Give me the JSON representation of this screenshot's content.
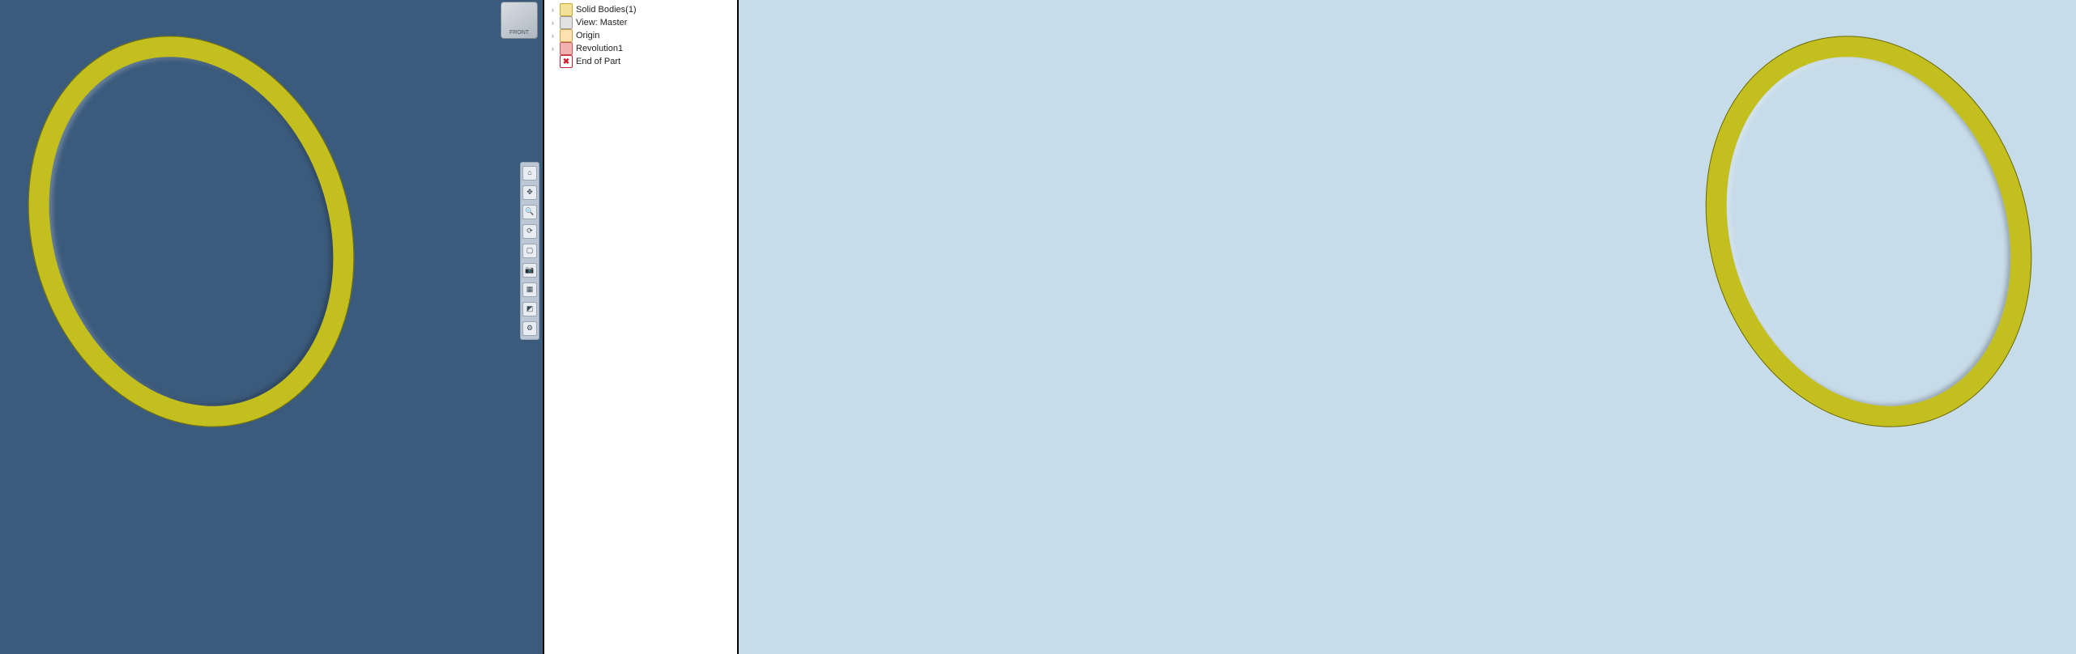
{
  "viewcube": {
    "label": "FRONT"
  },
  "side_toolbar": {
    "buttons": [
      {
        "name": "home-icon",
        "glyph": "⌂"
      },
      {
        "name": "pan-icon",
        "glyph": "✥"
      },
      {
        "name": "zoom-icon",
        "glyph": "🔍"
      },
      {
        "name": "orbit-icon",
        "glyph": "⟳"
      },
      {
        "name": "lookat-icon",
        "glyph": "▢"
      },
      {
        "name": "camera-icon",
        "glyph": "📷"
      },
      {
        "name": "section-icon",
        "glyph": "▦"
      },
      {
        "name": "material-icon",
        "glyph": "◩"
      },
      {
        "name": "settings-icon",
        "glyph": "⚙"
      }
    ]
  },
  "browser": {
    "items": [
      {
        "name": "node-solid-bodies",
        "icon": "solid",
        "expander": "›",
        "label": "Solid Bodies(1)"
      },
      {
        "name": "node-view-master",
        "icon": "view",
        "expander": "›",
        "label": "View: Master"
      },
      {
        "name": "node-origin",
        "icon": "origin",
        "expander": "›",
        "label": "Origin"
      },
      {
        "name": "node-revolution1",
        "icon": "rev",
        "expander": "›",
        "label": "Revolution1"
      },
      {
        "name": "node-end-of-part",
        "icon": "end",
        "expander": "",
        "label": "End of Part"
      }
    ]
  }
}
